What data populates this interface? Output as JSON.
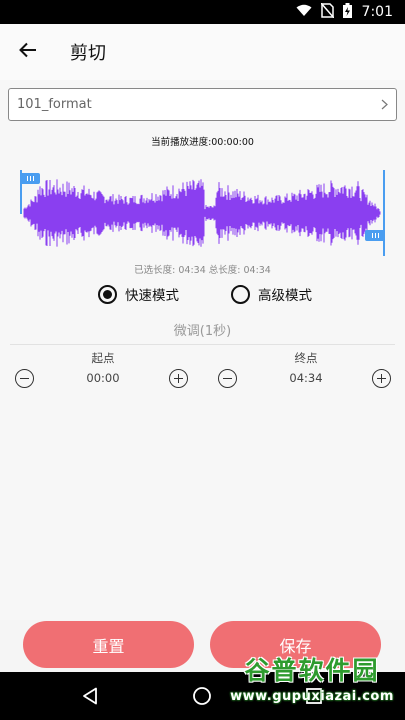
{
  "status_bar": {
    "time": "7:01",
    "icons": [
      "wifi-icon",
      "no-sim-icon",
      "battery-charging-icon"
    ]
  },
  "app_bar": {
    "back_icon": "arrow-left-icon",
    "title": "剪切"
  },
  "file": {
    "name": "101_format",
    "chevron_icon": "chevron-right-icon"
  },
  "progress_text": "当前播放进度:00:00:00",
  "waveform": {
    "color": "#8a3ff0",
    "handle_color": "#4a9df0",
    "selection_start_fraction": 0.0,
    "selection_end_fraction": 1.0
  },
  "length_text": "已选长度: 04:34 总长度: 04:34",
  "modes": {
    "fast": {
      "label": "快速模式",
      "selected": true
    },
    "advanced": {
      "label": "高级模式",
      "selected": false
    }
  },
  "fine_adjust": {
    "title": "微调(1秒)",
    "start": {
      "label": "起点",
      "value": "00:00"
    },
    "end": {
      "label": "终点",
      "value": "04:34"
    }
  },
  "actions": {
    "reset_label": "重置",
    "save_label": "保存",
    "color": "#f06f73"
  },
  "nav_bar": {
    "icons": [
      "back-triangle-icon",
      "home-circle-icon",
      "recents-square-icon"
    ]
  },
  "watermark": {
    "title": "谷普软件园",
    "url": "www.gupuxiazai.com"
  }
}
